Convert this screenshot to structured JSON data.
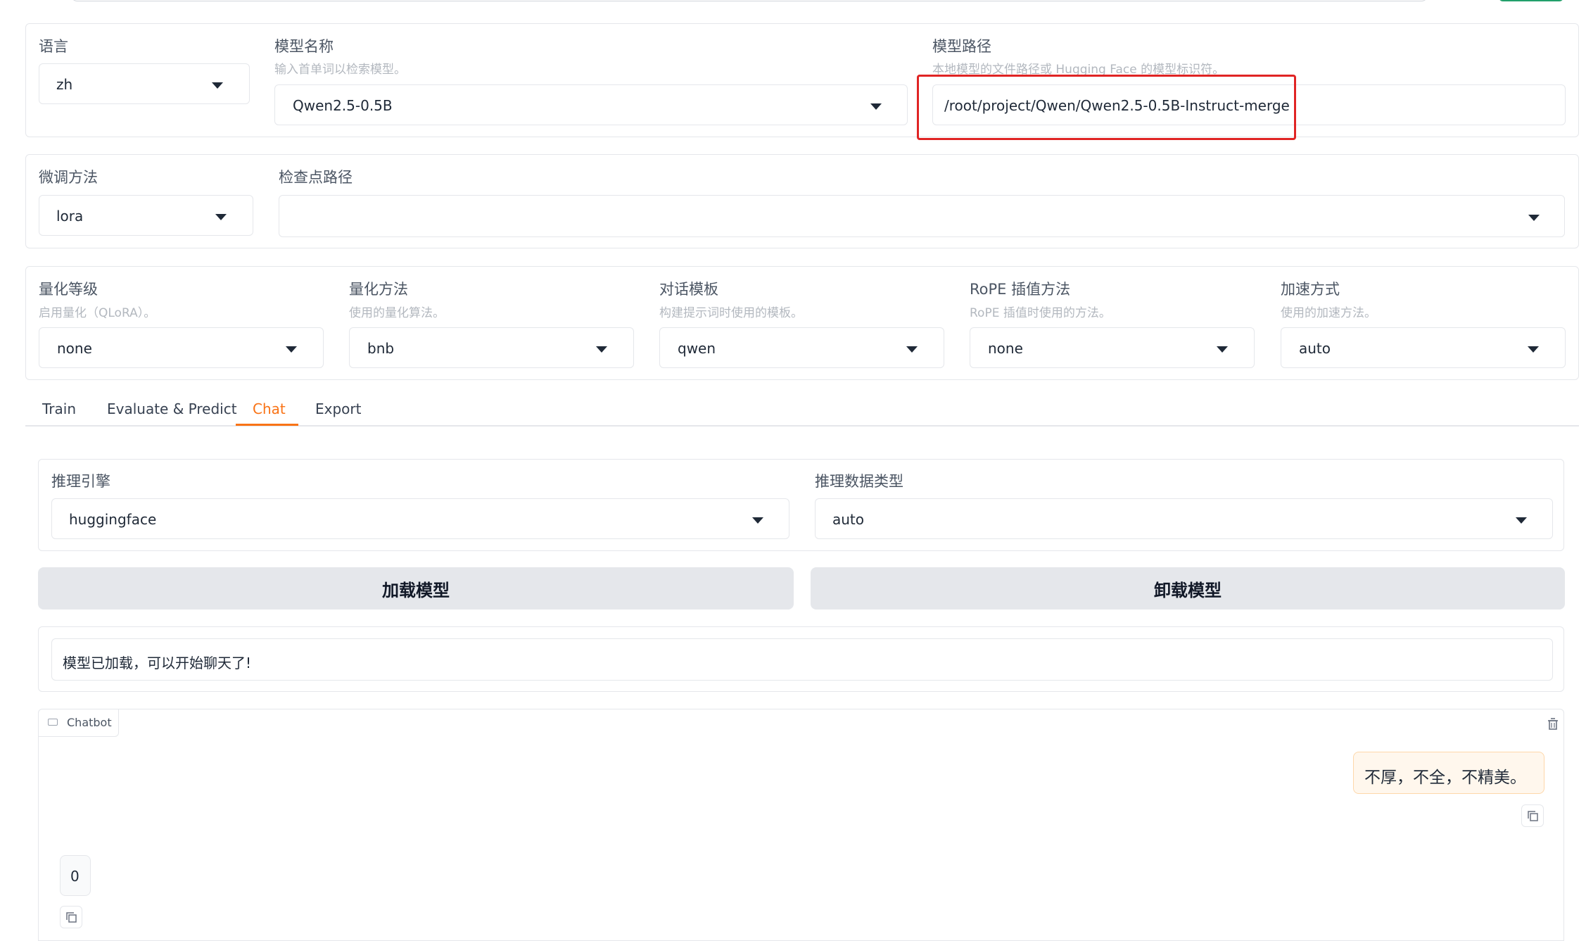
{
  "config": {
    "language": {
      "label": "语言",
      "value": "zh"
    },
    "model_name": {
      "label": "模型名称",
      "hint": "输入首单词以检索模型。",
      "value": "Qwen2.5-0.5B"
    },
    "model_path": {
      "label": "模型路径",
      "hint": "本地模型的文件路径或 Hugging Face 的模型标识符。",
      "value": "/root/project/Qwen/Qwen2.5-0.5B-Instruct-merge"
    },
    "finetune_method": {
      "label": "微调方法",
      "value": "lora"
    },
    "checkpoint_path": {
      "label": "检查点路径",
      "value": ""
    },
    "quant_bit": {
      "label": "量化等级",
      "hint": "启用量化（QLoRA）。",
      "value": "none"
    },
    "quant_method": {
      "label": "量化方法",
      "hint": "使用的量化算法。",
      "value": "bnb"
    },
    "template": {
      "label": "对话模板",
      "hint": "构建提示词时使用的模板。",
      "value": "qwen"
    },
    "rope_scaling": {
      "label": "RoPE 插值方法",
      "hint": "RoPE 插值时使用的方法。",
      "value": "none"
    },
    "booster": {
      "label": "加速方式",
      "hint": "使用的加速方法。",
      "value": "auto"
    }
  },
  "tabs": [
    "Train",
    "Evaluate & Predict",
    "Chat",
    "Export"
  ],
  "active_tab": "Chat",
  "accent_color": "#f97316",
  "highlight_color": "#e02424",
  "chat": {
    "infer_backend": {
      "label": "推理引擎",
      "value": "huggingface"
    },
    "infer_dtype": {
      "label": "推理数据类型",
      "value": "auto"
    },
    "load_button": "加载模型",
    "unload_button": "卸载模型",
    "info_box": "模型已加载，可以开始聊天了!",
    "chatbot": {
      "label": "Chatbot",
      "messages": [
        {
          "role": "user",
          "text": "不厚，不全，不精美。"
        },
        {
          "role": "bot",
          "text": "0"
        }
      ]
    }
  },
  "icons": [
    "chevron-down-icon",
    "chat-icon",
    "trash-icon",
    "copy-icon"
  ]
}
